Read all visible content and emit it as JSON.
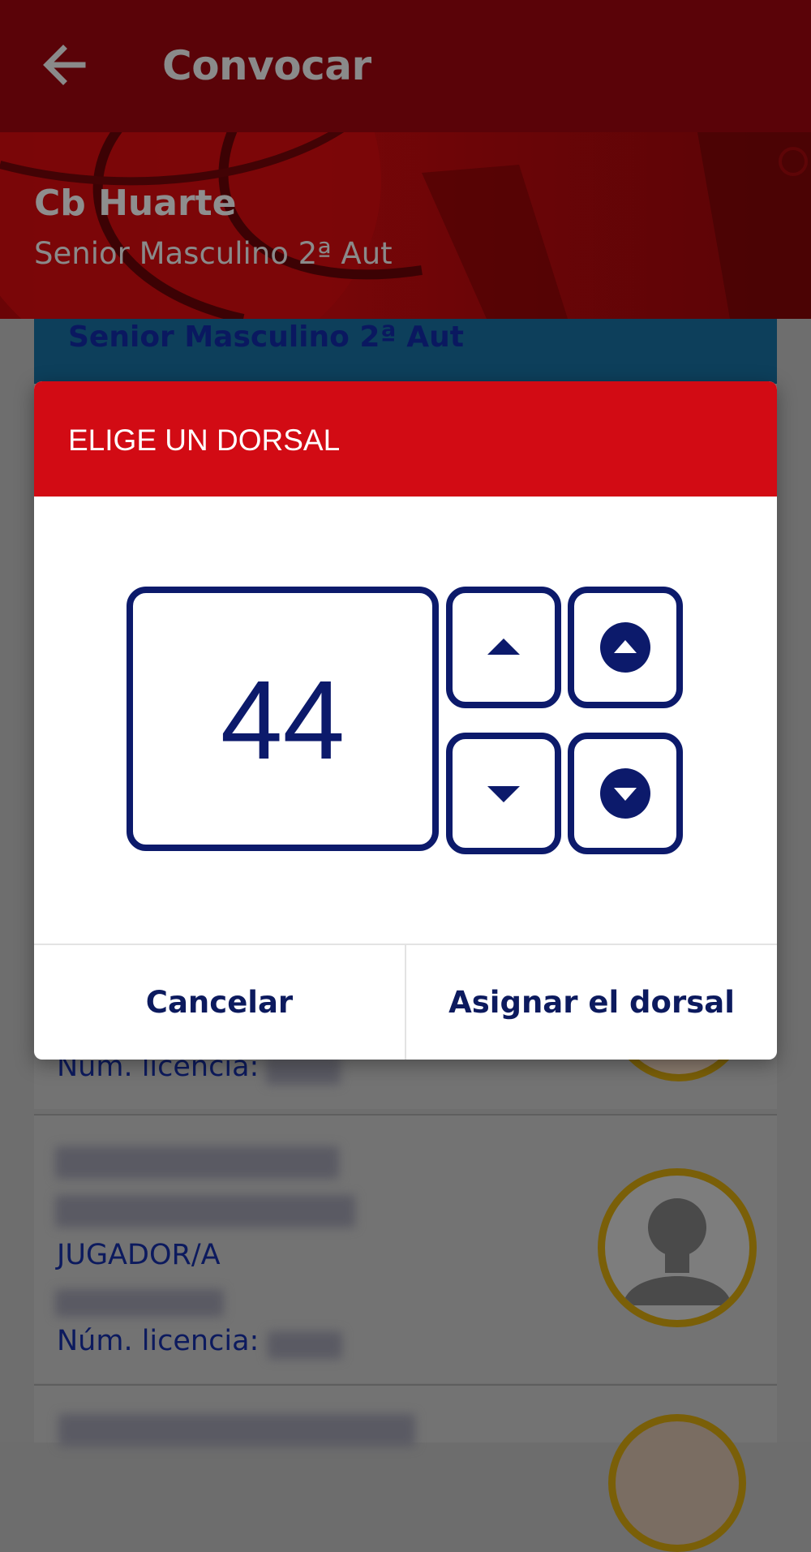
{
  "app_bar": {
    "title": "Convocar"
  },
  "banner": {
    "team": "Cb Huarte",
    "category": "Senior Masculino 2ª Aut"
  },
  "list": {
    "section_header": "Senior Masculino 2ª Aut",
    "players": [
      {
        "license_label": "Núm. licencia:"
      },
      {
        "role": "JUGADOR/A",
        "license_label": "Núm. licencia:"
      }
    ]
  },
  "dialog": {
    "title": "ELIGE UN DORSAL",
    "value": "44",
    "cancel_label": "Cancelar",
    "assign_label": "Asignar el dorsal"
  },
  "colors": {
    "dialog_header": "#d20b14",
    "navy": "#0c1a6b",
    "avatar_ring": "#d4a50c"
  },
  "icons": {
    "back": "arrow-left-icon",
    "increment": "caret-up-icon",
    "increment_fast": "circle-caret-up-icon",
    "decrement": "caret-down-icon",
    "decrement_fast": "circle-caret-down-icon",
    "avatar": "person-silhouette-icon"
  }
}
